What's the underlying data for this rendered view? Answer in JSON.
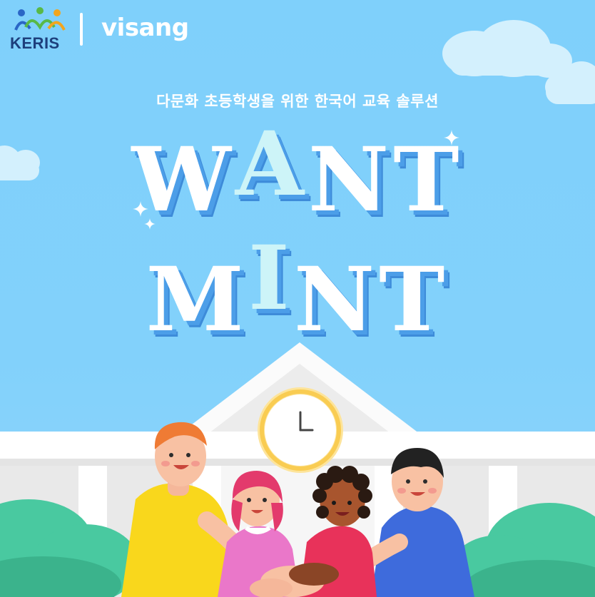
{
  "header": {
    "keris_logo_text": "KERIS",
    "visang_logo_text": "visang"
  },
  "subtitle": "다문화 초등학생을 위한 한국어 교육 솔루션",
  "title": {
    "line1_prefix": "W",
    "line1_highlight": "A",
    "line1_suffix": "NT",
    "line2_prefix": "M",
    "line2_highlight": "I",
    "line2_suffix": "NT"
  },
  "colors": {
    "sky": "#7fcffa",
    "title_shadow": "#4c9ee8",
    "highlight_letter": "#cdf4f8",
    "building": "#f2f2f2",
    "clock_ring": "#fbe58c",
    "bush": "#48c9a0"
  },
  "icons": [
    "keris-people-icon",
    "sparkle-icon",
    "clock-icon",
    "cloud-icon"
  ]
}
